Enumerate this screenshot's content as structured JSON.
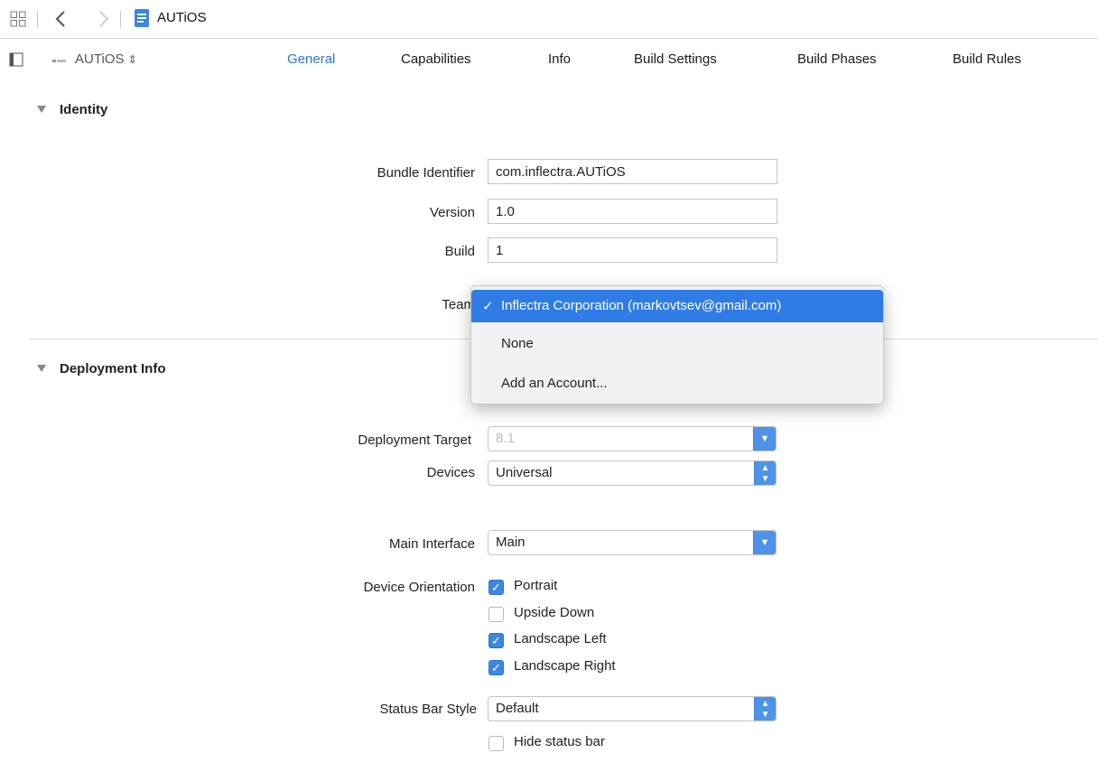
{
  "breadcrumb": {
    "project_name": "AUTiOS"
  },
  "target_selector": {
    "label": "AUTiOS"
  },
  "tabs": [
    {
      "label": "General",
      "active": true
    },
    {
      "label": "Capabilities",
      "active": false
    },
    {
      "label": "Info",
      "active": false
    },
    {
      "label": "Build Settings",
      "active": false
    },
    {
      "label": "Build Phases",
      "active": false
    },
    {
      "label": "Build Rules",
      "active": false
    }
  ],
  "identity": {
    "heading": "Identity",
    "bundle_identifier_label": "Bundle Identifier",
    "bundle_identifier_value": "com.inflectra.AUTiOS",
    "version_label": "Version",
    "version_value": "1.0",
    "build_label": "Build",
    "build_value": "1",
    "team_label": "Team"
  },
  "team_menu": {
    "items": [
      {
        "label": "Inflectra Corporation (markovtsev@gmail.com)",
        "selected": true
      },
      {
        "label": "None",
        "selected": false
      },
      {
        "label": "Add an Account...",
        "selected": false
      }
    ]
  },
  "deployment": {
    "heading": "Deployment Info",
    "deployment_target_label": "Deployment Target",
    "deployment_target_value": "8.1",
    "devices_label": "Devices",
    "devices_value": "Universal",
    "main_interface_label": "Main Interface",
    "main_interface_value": "Main",
    "device_orientation_label": "Device Orientation",
    "orientations": [
      {
        "label": "Portrait",
        "checked": true
      },
      {
        "label": "Upside Down",
        "checked": false
      },
      {
        "label": "Landscape Left",
        "checked": true
      },
      {
        "label": "Landscape Right",
        "checked": true
      }
    ],
    "status_bar_style_label": "Status Bar Style",
    "status_bar_style_value": "Default",
    "hide_status_bar_label": "Hide status bar",
    "hide_status_bar_checked": false
  },
  "colors": {
    "accent": "#2f7ce6",
    "active_tab": "#2a76d6"
  }
}
